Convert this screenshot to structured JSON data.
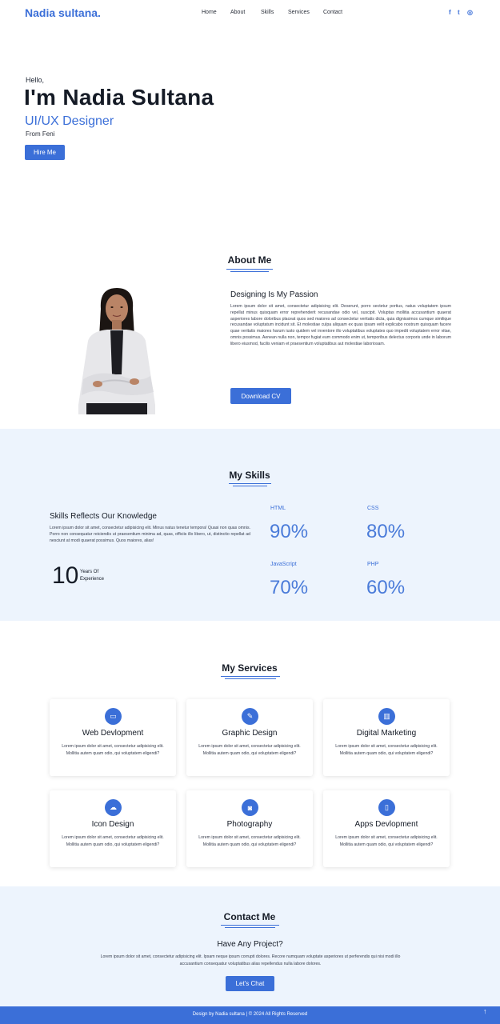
{
  "nav": {
    "brand": "Nadia sultana.",
    "items": [
      "Home",
      "About",
      "Skills",
      "Services",
      "Contact"
    ],
    "social": [
      "facebook-icon",
      "twitter-icon",
      "instagram-icon"
    ],
    "social_glyphs": [
      "f",
      "t",
      "◎"
    ]
  },
  "hero": {
    "greeting": "Hello,",
    "name": "I'm Nadia Sultana",
    "role": "UI/UX Designer",
    "from": "From Feni",
    "button": "Hire Me"
  },
  "about": {
    "title": "About Me",
    "subtitle": "Designing Is My Passion",
    "paragraph": "Lorem ipsum dolor sit amet, consectetur adipisicing elit. Deserunt, porro sectetur portius, natus voluptatem ipsum repellat minus quisquam error reprehenderit recusandae odio vel, suscipit. Voluptas mollitia accusantium quaerat asperiores labore doloribus placeat quos sed maiores ad consectetur veritatis dicta, quia dignissimos cumque similique recusandae voluptatum incidunt sit. Et molestiae culpa aliquam ex quas ipsam velit explicabo nostrum quisquam facere quae veritatis maiores harum iusto quidem vel inventore illo voluptatibus voluptates quo impedit voluptatem error vitae, omnis possimus. Aenean nulla non, tempor fugiat eum commodo enim ut, temporibus delectus corporis unde in laborum libero eiusmod, facilis veniam et praesentium voluptatibus aut molestiae laboriosam.",
    "button": "Download CV"
  },
  "skills": {
    "title": "My Skills",
    "subtitle": "Skills Reflects Our Knowledge",
    "paragraph": "Lorem ipsum dolor sit amet, consectetur adipisicing elit. Minus natus tenetur tempora! Quasi non quas omnis. Porro non consequatur reiciendis ut praesentium minima ad, quas, officiis illo libero, ut, distinctio repellat ad nesciunt at modi quaerat possimus. Quos maiores, alias!",
    "years_number": "10",
    "years_line1": "Years Of",
    "years_line2": "Experience",
    "items": [
      {
        "name": "HTML",
        "value": "90%"
      },
      {
        "name": "CSS",
        "value": "80%"
      },
      {
        "name": "JavaScript",
        "value": "70%"
      },
      {
        "name": "PHP",
        "value": "60%"
      }
    ]
  },
  "services": {
    "title": "My Services",
    "items": [
      {
        "title": "Web Devlopment",
        "icon": "monitor-icon",
        "glyph": "▭",
        "text": "Lorem ipsum dolor sit amet, consectetur adipisicing elit. Mollitia autem quam odio, qui voluptatem eligendi?"
      },
      {
        "title": "Graphic Design",
        "icon": "pen-icon",
        "glyph": "✎",
        "text": "Lorem ipsum dolor sit amet, consectetur adipisicing elit. Mollitia autem quam odio, qui voluptatem eligendi?"
      },
      {
        "title": "Digital Marketing",
        "icon": "chart-icon",
        "glyph": "▥",
        "text": "Lorem ipsum dolor sit amet, consectetur adipisicing elit. Mollitia autem quam odio, qui voluptatem eligendi?"
      },
      {
        "title": "Icon Design",
        "icon": "cloud-icon",
        "glyph": "☁",
        "text": "Lorem ipsum dolor sit amet, consectetur adipisicing elit. Mollitia autem quam odio, qui voluptatem eligendi?"
      },
      {
        "title": "Photography",
        "icon": "camera-icon",
        "glyph": "◙",
        "text": "Lorem ipsum dolor sit amet, consectetur adipisicing elit. Mollitia autem quam odio, qui voluptatem eligendi?"
      },
      {
        "title": "Apps Devlopment",
        "icon": "mobile-icon",
        "glyph": "▯",
        "text": "Lorem ipsum dolor sit amet, consectetur adipisicing elit. Mollitia autem quam odio, qui voluptatem eligendi?"
      }
    ]
  },
  "contact": {
    "title": "Contact Me",
    "subtitle": "Have Any Project?",
    "paragraph": "Lorem ipsum dolor sit amet, consectetur adipisicing elit. Ipsam neque ipsum corrupti dolores. Recore numquam voluptate asperiores ut perferendis qui nisi modi illo accusantium consequatur voluptatibus alias repellendus nulla labore dolores.",
    "button": "Let's Chat"
  },
  "footer": {
    "text": "Design by Nadia sultana | © 2024 All Rights Reserved",
    "top_glyph": "↑"
  },
  "colors": {
    "accent": "#3b6fd8",
    "section_bg": "#edf4fd",
    "text_dark": "#151b26"
  }
}
